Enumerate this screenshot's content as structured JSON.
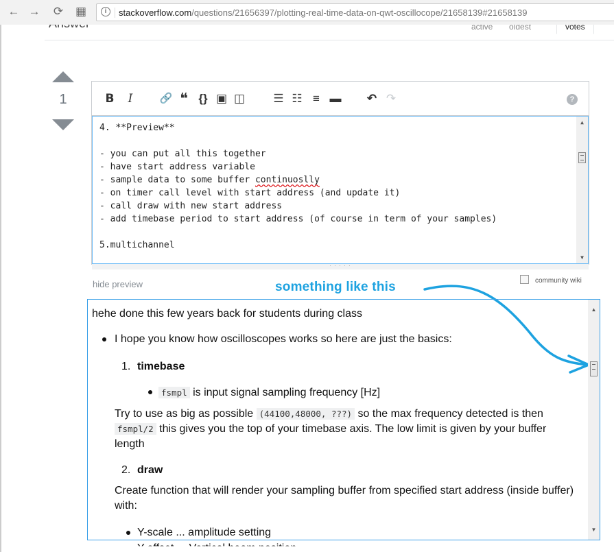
{
  "browser": {
    "nav": {
      "back_icon": "←",
      "forward_icon": "→",
      "reload_icon": "⟳",
      "apps_icon": "▦"
    },
    "url_host": "stackoverflow.com",
    "url_path": "/questions/21656397/plotting-real-time-data-on-qwt-oscillocope/21658139#21658139"
  },
  "answers_header": {
    "title_partial": "Answer",
    "tabs": {
      "active": "active",
      "oldest": "oldest",
      "votes": "votes"
    }
  },
  "votes": {
    "count": "1"
  },
  "toolbar": {
    "bold": "B",
    "italic": "I",
    "link": "🔗",
    "blockquote": "❝",
    "code": "{}",
    "image": "▣",
    "snippet": "◫",
    "ordered_list": "☰",
    "bulleted_list": "☷",
    "heading": "≡",
    "hr": "▬",
    "undo": "↶",
    "redo": "↷",
    "help": "?"
  },
  "editor": {
    "lines": [
      "4. **Preview**",
      "",
      "- you can put all this together",
      "- have start address variable",
      "- sample data to some buffer ",
      "- on timer call level with start address (and update it)",
      "- call draw with new start address",
      "- add timebase period to start address (of course in term of your samples)",
      "",
      "5.multichannel"
    ],
    "misspelled_word": "continuoslly",
    "grip": "· · · · ·"
  },
  "hide_preview": "hide preview",
  "community_wiki": "community wiki",
  "annotation": "something like this",
  "preview": {
    "intro": "hehe done this few years back for students during class",
    "bullet1": "I hope you know how oscilloscopes works so here are just the basics:",
    "item1_num": "1.",
    "item1_title": "timebase",
    "fsmpl_code": "fsmpl",
    "fsmpl_text": "is input signal sampling frequency [Hz]",
    "try_text_a": "Try to use as big as possible",
    "try_code": "(44100,48000, ???)",
    "try_text_b": "so the max frequency detected is then",
    "fsmpl2_code": "fsmpl/2",
    "try_text_c": "this gives you the top of your timebase axis. The low limit is given by your buffer",
    "try_text_d": "length",
    "item2_num": "2.",
    "item2_title": "draw",
    "draw_text_a": "Create function that will render your sampling buffer from specified start address (inside buffer)",
    "draw_text_b": "with:",
    "yscale": "Y-scale ... amplitude setting",
    "next_cut": "Y-offset ... Vertical beam position"
  },
  "colors": {
    "annotation": "#1da2e0",
    "focus_border": "#6cbbf7",
    "vote_arrow": "#858c93"
  }
}
